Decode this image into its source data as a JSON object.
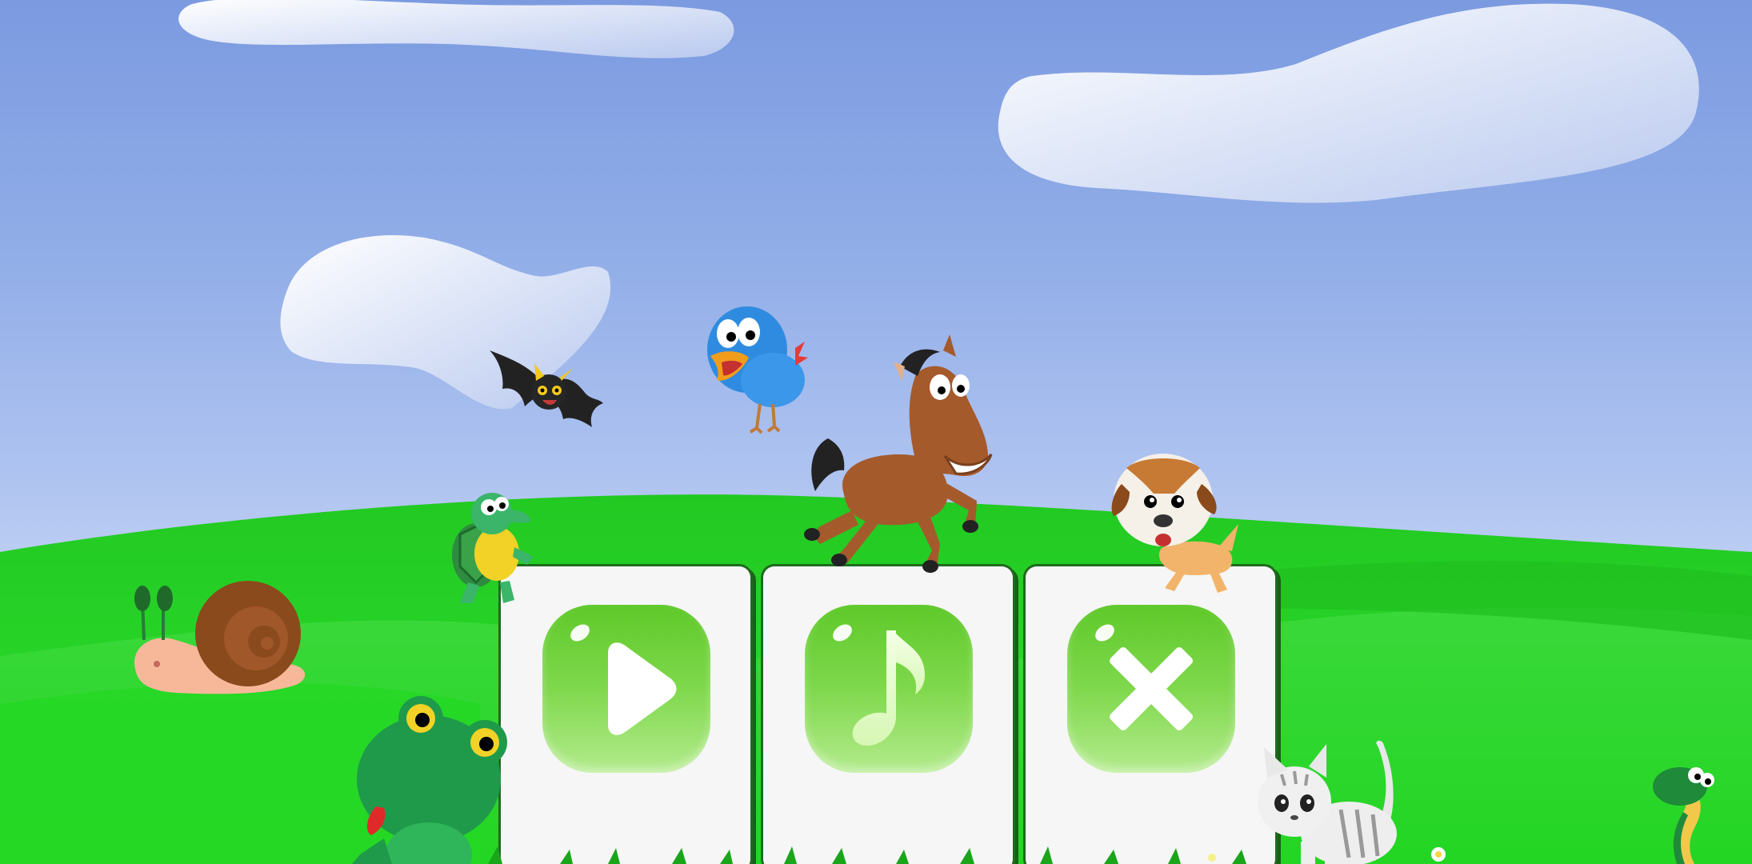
{
  "screen": "main-menu",
  "menu": {
    "buttons": [
      {
        "id": "play",
        "icon": "play-icon"
      },
      {
        "id": "music",
        "icon": "music-note-icon"
      },
      {
        "id": "close",
        "icon": "close-x-icon"
      }
    ]
  },
  "characters": [
    "bat-icon",
    "bird-icon",
    "horse-icon",
    "dog-icon",
    "turtle-icon",
    "snail-icon",
    "frog-icon",
    "cat-icon",
    "snake-icon"
  ],
  "colors": {
    "sky_top": "#7b9ae0",
    "sky_bottom": "#c2d3f4",
    "grass": "#2bd92b",
    "button_green": "#6fd33a",
    "panel": "#f6f6f6"
  }
}
